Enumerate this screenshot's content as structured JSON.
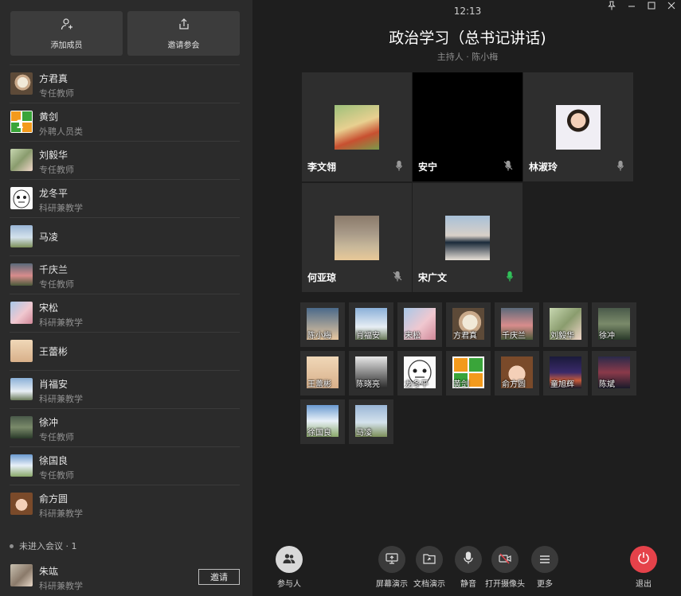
{
  "sidebar": {
    "add_member_label": "添加成员",
    "invite_label": "邀请参会",
    "members": [
      {
        "name": "",
        "role": "科研兼教学"
      },
      {
        "name": "方君真",
        "role": "专任教师"
      },
      {
        "name": "黄剑",
        "role": "外聘人员类"
      },
      {
        "name": "刘毅华",
        "role": "专任教师"
      },
      {
        "name": "龙冬平",
        "role": "科研兼教学"
      },
      {
        "name": "马凌",
        "role": ""
      },
      {
        "name": "千庆兰",
        "role": "专任教师"
      },
      {
        "name": "宋松",
        "role": "科研兼教学"
      },
      {
        "name": "王蕾彬",
        "role": ""
      },
      {
        "name": "肖福安",
        "role": "科研兼教学"
      },
      {
        "name": "徐冲",
        "role": "专任教师"
      },
      {
        "name": "徐国良",
        "role": "专任教师"
      },
      {
        "name": "俞方圆",
        "role": "科研兼教学"
      }
    ],
    "not_joined_label": "未进入会议 · 1",
    "not_joined_member": {
      "name": "朱竑",
      "role": "科研兼教学",
      "invite_button": "邀请"
    }
  },
  "header": {
    "time": "12:13",
    "title": "政治学习（总书记讲话)",
    "host": "主持人 · 陈小梅"
  },
  "video_tiles": [
    {
      "name": "李文翎",
      "mic": "muted"
    },
    {
      "name": "安宁",
      "mic": "muted"
    },
    {
      "name": "林淑玲",
      "mic": "muted"
    },
    {
      "name": "何亚琼",
      "mic": "muted"
    },
    {
      "name": "宋广文",
      "mic": "active"
    }
  ],
  "thumbnails": [
    "陈小梅",
    "肖福安",
    "宋松",
    "方君真",
    "千庆兰",
    "刘毅华",
    "徐冲",
    "王蕾彬",
    "陈晓亮",
    "龙冬平",
    "黄剑",
    "俞方圆",
    "童旭辉",
    "陈斌",
    "徐国良",
    "马凌"
  ],
  "toolbar": {
    "participants": "参与人",
    "screen_share": "屏幕演示",
    "doc_share": "文档演示",
    "mute": "静音",
    "camera": "打开摄像头",
    "more": "更多",
    "exit": "退出"
  },
  "colors": {
    "accent_green": "#31c25a",
    "exit_red": "#e5424a",
    "sidebar_bg": "#2b2b2b",
    "main_bg": "#1e1e1e"
  },
  "icons": [
    "add-user-icon",
    "share-icon",
    "mic-muted-icon",
    "mic-active-icon",
    "participants-icon",
    "screen-share-icon",
    "doc-share-icon",
    "mic-icon",
    "camera-off-icon",
    "more-icon",
    "power-icon",
    "pin-icon",
    "minimize-icon",
    "maximize-icon",
    "close-icon"
  ]
}
